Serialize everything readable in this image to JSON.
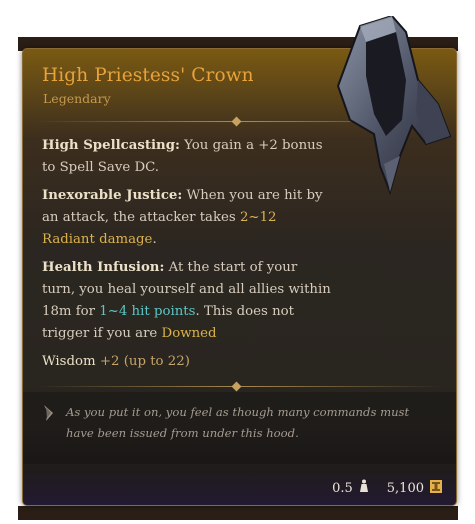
{
  "item": {
    "name": "High Priestess' Crown",
    "rarity": "Legendary"
  },
  "properties": [
    {
      "label": "High Spellcasting:",
      "text": " You gain a +2 bonus to Spell Save DC."
    },
    {
      "label": "Inexorable Justice:",
      "text_before": " When you are hit by an attack, the attacker takes ",
      "highlight": "2~12 Radiant damage",
      "text_after": "."
    },
    {
      "label": "Health Infusion:",
      "text_before": " At the start of your turn, you heal yourself and all allies within 18m for ",
      "highlight": "1~4 hit points",
      "text_middle": ". This does not trigger if you are ",
      "highlight2": "Downed"
    }
  ],
  "stat": {
    "label": "Wisdom",
    "value": "+2 (up to 22)"
  },
  "flavor_text": "As you put it on, you feel as though many commands must have been issued from under this hood.",
  "footer": {
    "weight": "0.5",
    "weight_icon": "weight-icon",
    "value": "5,100",
    "value_icon": "gold-coin-icon"
  },
  "colors": {
    "title": "#e8a33a",
    "highlight_damage": "#dcb24a",
    "highlight_heal": "#5bc7c6"
  }
}
